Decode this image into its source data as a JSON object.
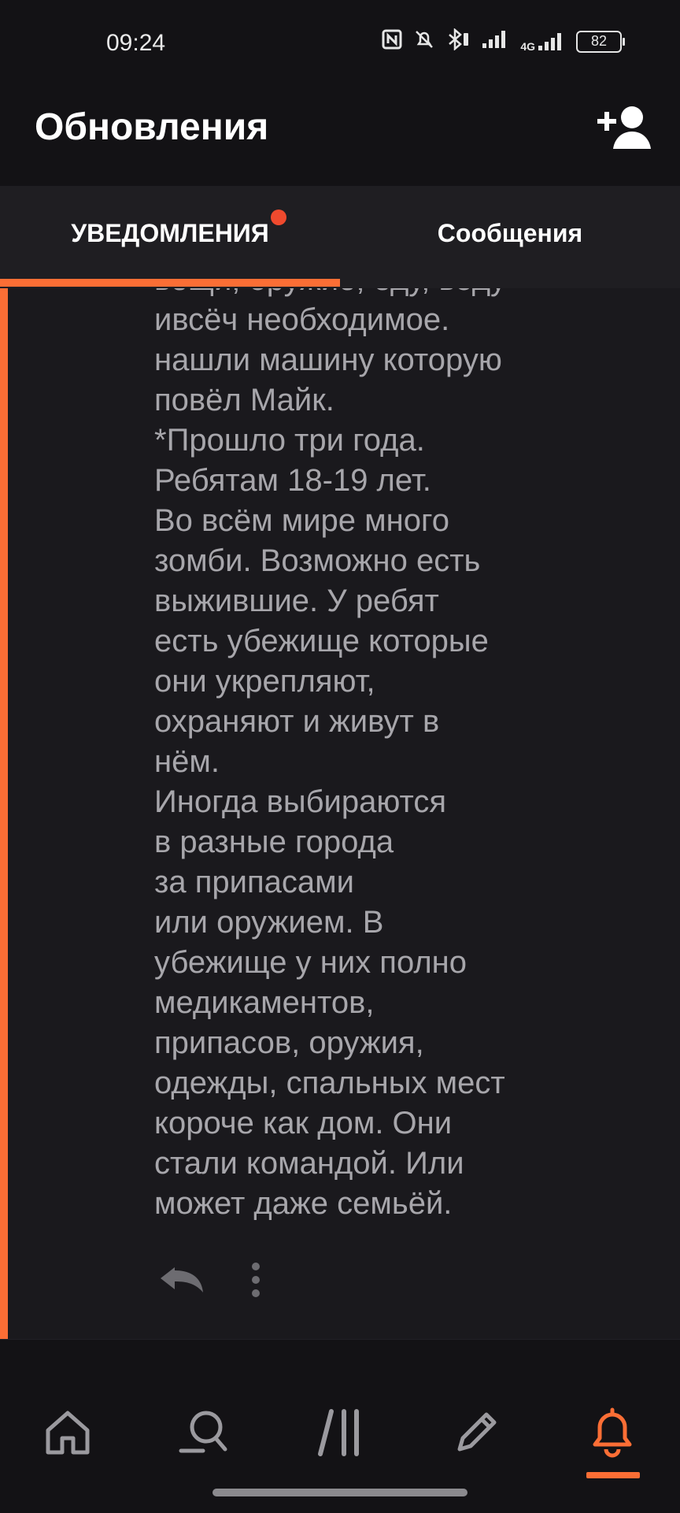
{
  "status_bar": {
    "time": "09:24",
    "battery": "82",
    "network": "4G"
  },
  "header": {
    "title": "Обновления",
    "add_user_icon": "add-user-icon"
  },
  "tabs": [
    {
      "label": "УВЕДОМЛЕНИЯ",
      "active": true,
      "has_badge": true
    },
    {
      "label": "Сообщения",
      "active": false,
      "has_badge": false
    }
  ],
  "message": {
    "text": "вещи, оружие, еду, воду\nивсёч необходимое.\nнашли машину которую\nповёл Майк.\n*Прошло три года.\nРебятам 18-19 лет.\nВо всём мире много\nзомби. Возможно есть\nвыжившие. У ребят\nесть убежище которые\nони укрепляют,\nохраняют и живут в\nнём.\nИногда выбираются\nв разные города\nза припасами\nили оружием. В\nубежище у них полно\nмедикаментов,\nприпасов, оружия,\nодежды, спальных мест\nкороче как дом. Они\nстали командой. Или\nможет даже семьёй."
  },
  "bottom_nav": [
    {
      "icon": "home-icon",
      "active": false
    },
    {
      "icon": "search-icon",
      "active": false
    },
    {
      "icon": "library-icon",
      "active": false
    },
    {
      "icon": "pencil-icon",
      "active": false
    },
    {
      "icon": "bell-icon",
      "active": true
    }
  ],
  "colors": {
    "accent": "#fb6e35",
    "badge": "#ef4a2e",
    "text_muted": "#a7a6ab",
    "background": "#1a191d"
  }
}
